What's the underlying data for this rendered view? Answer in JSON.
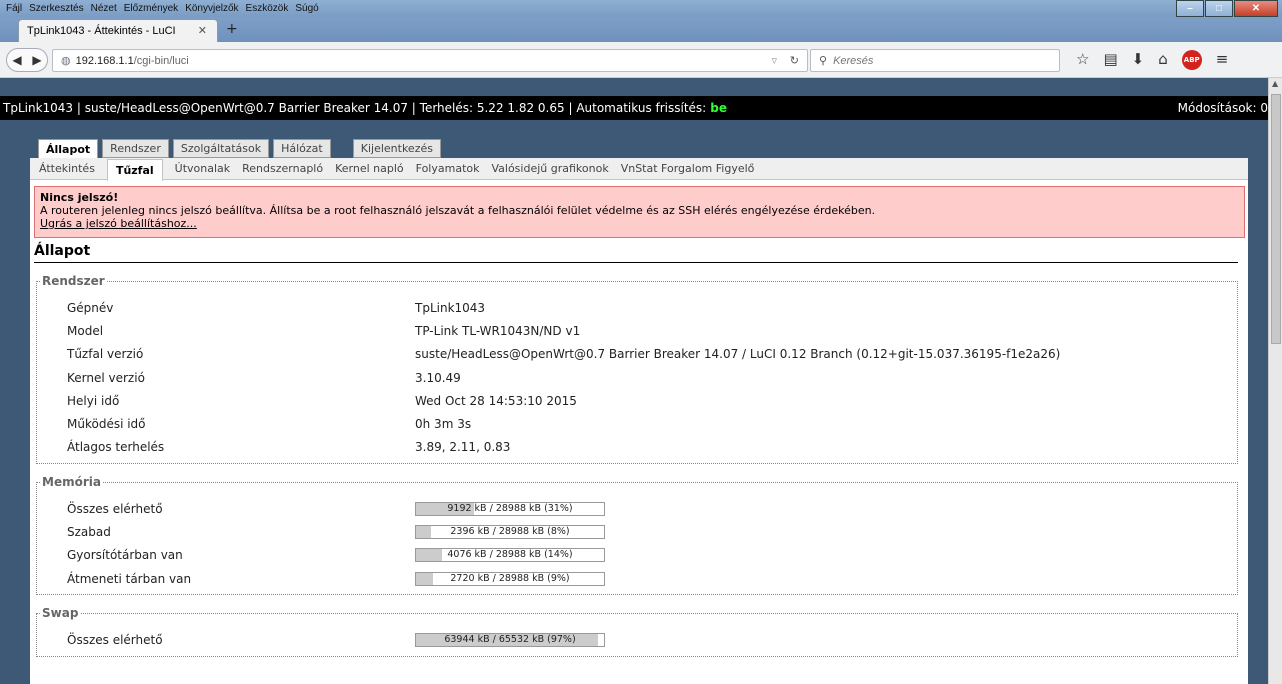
{
  "browser": {
    "menu": [
      "Fájl",
      "Szerkesztés",
      "Nézet",
      "Előzmények",
      "Könyvjelzők",
      "Eszközök",
      "Súgó"
    ],
    "tab_title": "TpLink1043 - Áttekintés - LuCI",
    "url_host": "192.168.1.1",
    "url_path": "/cgi-bin/luci",
    "search_placeholder": "Keresés"
  },
  "header": {
    "text": "TpLink1043 | suste/HeadLess@OpenWrt@0.7 Barrier Breaker 14.07 | Terhelés: 5.22 1.82 0.65 | Automatikus frissítés:",
    "refresh_state": "be",
    "changes": "Módosítások: 0"
  },
  "main_tabs": [
    "Állapot",
    "Rendszer",
    "Szolgáltatások",
    "Hálózat",
    "Kijelentkezés"
  ],
  "sub_tabs": [
    "Áttekintés",
    "Tűzfal",
    "Útvonalak",
    "Rendszernapló",
    "Kernel napló",
    "Folyamatok",
    "Valósidejű grafikonok",
    "VnStat Forgalom Figyelő"
  ],
  "alert": {
    "title": "Nincs jelszó!",
    "text": "A routeren jelenleg nincs jelszó beállítva. Állítsa be a root felhasználó jelszavát a felhasználói felület védelme és az SSH elérés engélyezése érdekében.",
    "link": "Ugrás a jelszó beállításhoz..."
  },
  "page_title": "Állapot",
  "system": {
    "legend": "Rendszer",
    "rows": [
      {
        "label": "Gépnév",
        "value": "TpLink1043"
      },
      {
        "label": "Model",
        "value": "TP-Link TL-WR1043N/ND v1"
      },
      {
        "label": "Tűzfal verzió",
        "value": "suste/HeadLess@OpenWrt@0.7 Barrier Breaker 14.07 / LuCI 0.12 Branch (0.12+git-15.037.36195-f1e2a26)"
      },
      {
        "label": "Kernel verzió",
        "value": "3.10.49"
      },
      {
        "label": "Helyi idő",
        "value": "Wed Oct 28 14:53:10 2015"
      },
      {
        "label": "Működési idő",
        "value": "0h 3m 3s"
      },
      {
        "label": "Átlagos terhelés",
        "value": "3.89, 2.11, 0.83"
      }
    ]
  },
  "memory": {
    "legend": "Memória",
    "rows": [
      {
        "label": "Összes elérhető",
        "value": "9192 kB / 28988 kB (31%)",
        "pct": 31
      },
      {
        "label": "Szabad",
        "value": "2396 kB / 28988 kB (8%)",
        "pct": 8
      },
      {
        "label": "Gyorsítótárban van",
        "value": "4076 kB / 28988 kB (14%)",
        "pct": 14
      },
      {
        "label": "Átmeneti tárban van",
        "value": "2720 kB / 28988 kB (9%)",
        "pct": 9
      }
    ]
  },
  "swap": {
    "legend": "Swap",
    "rows": [
      {
        "label": "Összes elérhető",
        "value": "63944 kB / 65532 kB (97%)",
        "pct": 97
      }
    ]
  }
}
